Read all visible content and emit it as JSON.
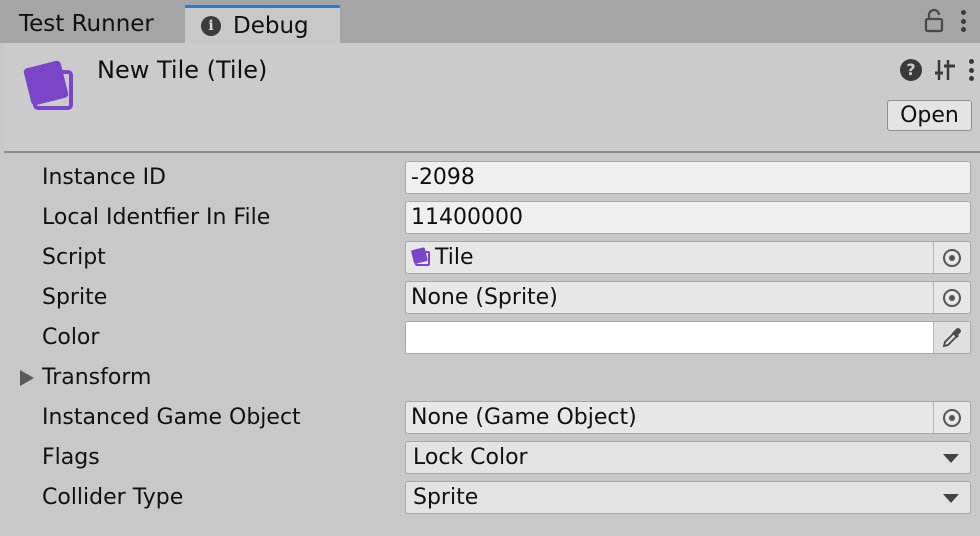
{
  "tabs": [
    {
      "label": "Test Runner",
      "active": false
    },
    {
      "label": "Debug",
      "active": true,
      "icon": "info-icon"
    }
  ],
  "header": {
    "title": "New Tile (Tile)",
    "open_label": "Open",
    "asset_icon": "tile-asset-icon",
    "accent_color": "#7a45c8"
  },
  "properties": {
    "instance_id": {
      "label": "Instance ID",
      "value": "-2098"
    },
    "local_identifier": {
      "label": "Local Identfier In File",
      "value": "11400000"
    },
    "script": {
      "label": "Script",
      "value": "Tile"
    },
    "sprite": {
      "label": "Sprite",
      "value": "None (Sprite)"
    },
    "color": {
      "label": "Color",
      "value": "#ffffff"
    },
    "transform": {
      "label": "Transform",
      "expanded": false
    },
    "instanced_game_object": {
      "label": "Instanced Game Object",
      "value": "None (Game Object)"
    },
    "flags": {
      "label": "Flags",
      "value": "Lock Color"
    },
    "collider_type": {
      "label": "Collider Type",
      "value": "Sprite"
    }
  },
  "colors": {
    "tab_active_accent": "#3a79bb",
    "panel_bg": "#c8c8c8"
  }
}
